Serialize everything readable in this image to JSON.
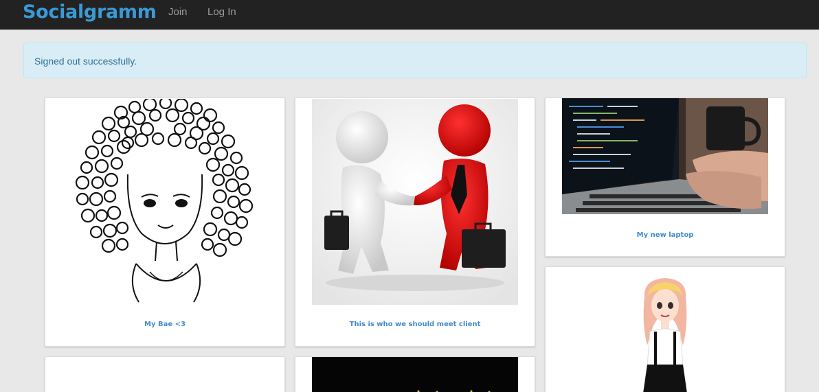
{
  "navbar": {
    "brand": "Socialgramm",
    "links": [
      "Join",
      "Log In"
    ]
  },
  "alert": {
    "message": "Signed out successfully."
  },
  "pins": [
    {
      "caption": "My Bae <3",
      "image": "curly-hair-girl-sketch"
    },
    {
      "caption": "This is who we should meet client",
      "image": "3d-figures-handshake"
    },
    {
      "caption": "My new laptop",
      "image": "laptop-coding"
    },
    {
      "caption": "",
      "image": "cartoon-girl-pink-hair"
    },
    {
      "caption": "",
      "image": "blank-image"
    },
    {
      "caption": "",
      "image": "dark-image"
    }
  ],
  "colors": {
    "brand": "#3b9ad6",
    "navbar": "#222222",
    "alert_bg": "#d9edf7",
    "alert_text": "#31708f",
    "caption": "#428bca"
  }
}
